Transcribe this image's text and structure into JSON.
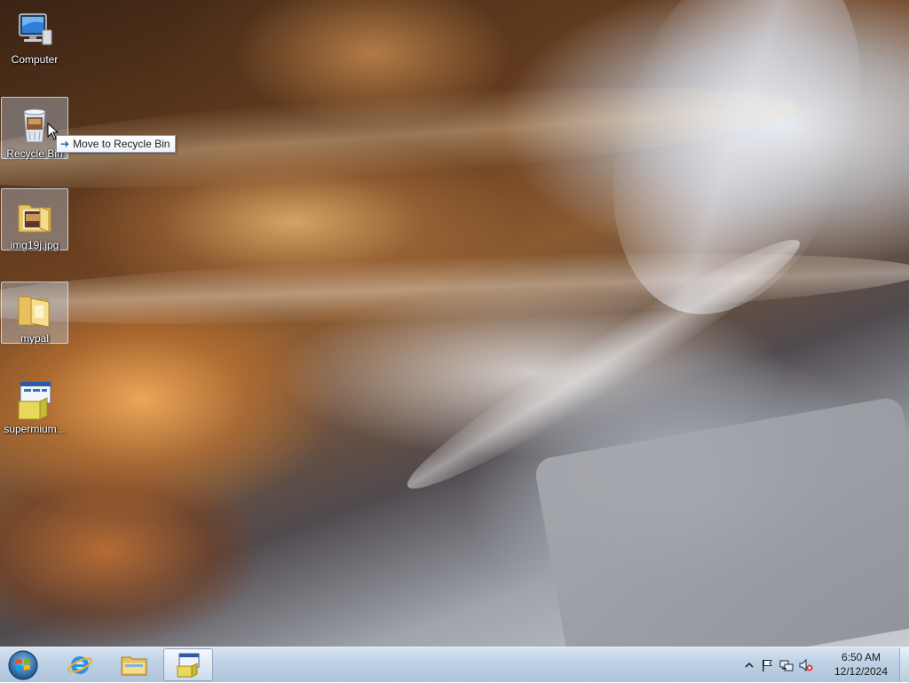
{
  "desktop": {
    "icons": [
      {
        "label": "Computer"
      },
      {
        "label": "Recycle Bin"
      },
      {
        "label": "img19j.jpg"
      },
      {
        "label": "mypal"
      },
      {
        "label": "supermium..."
      }
    ],
    "tooltip": {
      "text": "Move to Recycle Bin"
    }
  },
  "taskbar": {
    "clock": {
      "time": "6:50 AM",
      "date": "12/12/2024"
    },
    "tray_icons": [
      "chevron-up-icon",
      "flag-icon",
      "network-icon",
      "volume-muted-icon"
    ]
  },
  "colors": {
    "taskbar": "#bdd0e4",
    "tooltip_border": "#8a9ab0",
    "accent": "#1c5fb5"
  }
}
